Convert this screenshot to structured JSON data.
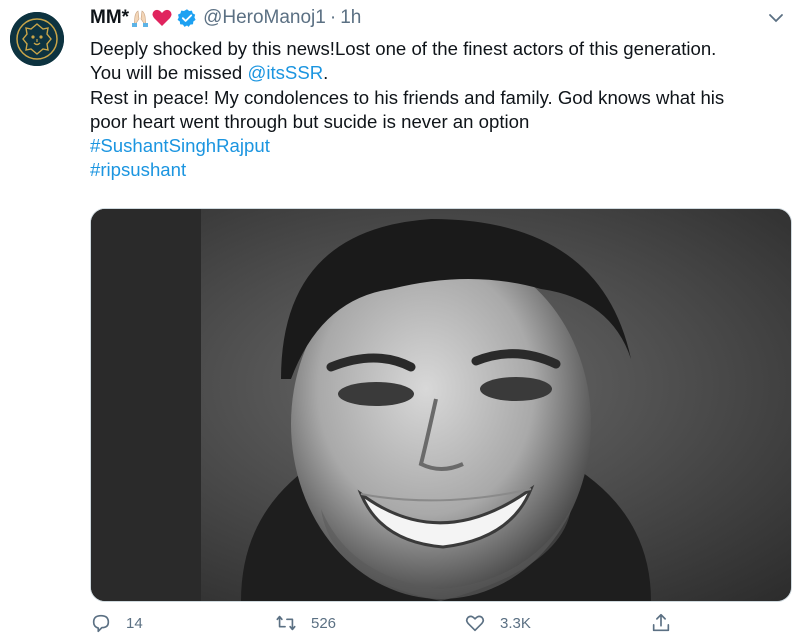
{
  "tweet": {
    "author": {
      "display_name": "MM*",
      "emoji": [
        "folded-hands",
        "red-heart"
      ],
      "verified": true,
      "handle": "@HeroManoj1",
      "separator": "·",
      "time": "1h",
      "avatar_icon": "golden-lion-crest"
    },
    "body": {
      "line1": "Deeply shocked by this news!Lost one of the finest actors of this generation.",
      "line2_prefix": "You will be missed ",
      "mention": "@itsSSR",
      "line2_suffix": ".",
      "line3": "Rest in peace! My condolences to his friends and family. God knows what his",
      "line4": "poor heart went through but sucide is never an option",
      "hashtags": [
        "#SushantSinghRajput",
        "#ripsushant"
      ]
    },
    "media": {
      "kind": "black-and-white portrait photo of a smiling man"
    },
    "actions": {
      "reply_count": "14",
      "retweet_count": "526",
      "like_count": "3.3K"
    }
  },
  "colors": {
    "link": "#1b95e0",
    "secondary_text": "#5b7083",
    "verified_badge": "#1da1f2",
    "heart": "#e0245e"
  }
}
